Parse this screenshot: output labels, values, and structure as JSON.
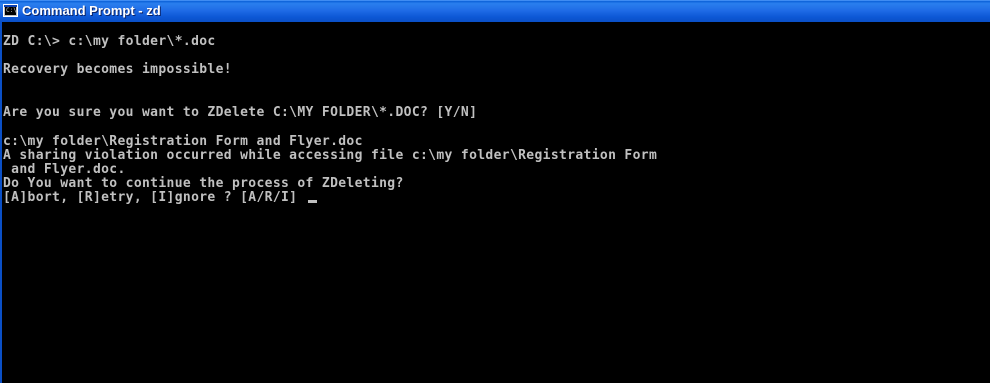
{
  "window": {
    "title": "Command Prompt - zd",
    "icon": "command-prompt-icon",
    "icon_text": "C:\\"
  },
  "console": {
    "lines": [
      "ZD C:\\> c:\\my folder\\*.doc",
      "Recovery becomes impossible!",
      "Are you sure you want to ZDelete C:\\MY FOLDER\\*.DOC? [Y/N]",
      "c:\\my folder\\Registration Form and Flyer.doc",
      "A sharing violation occurred while accessing file c:\\my folder\\Registration Form",
      " and Flyer.doc.",
      "Do You want to continue the process of ZDeleting?",
      "[A]bort, [R]etry, [I]gnore ? [A/R/I] "
    ]
  },
  "colors": {
    "console_background": "#000000",
    "console_text": "#c0c0c0",
    "titlebar": "#1f6be6",
    "title_text": "#ffffff"
  }
}
